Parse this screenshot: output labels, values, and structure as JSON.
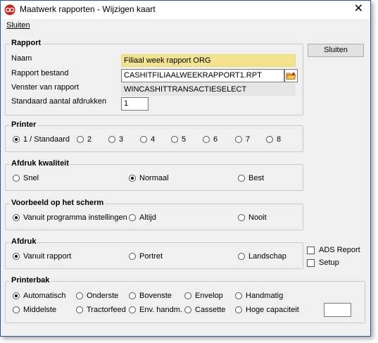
{
  "window": {
    "title": "Maatwerk rapporten - Wijzigen kaart",
    "close_glyph": "✕",
    "accent": "#cc2222"
  },
  "menu": {
    "items": [
      "Sluiten"
    ]
  },
  "close_button": "Sluiten",
  "rapport": {
    "legend": "Rapport",
    "naam_label": "Naam",
    "naam_value": "Filiaal week rapport ORG",
    "bestand_label": "Rapport bestand",
    "bestand_value": "CASHITFILIAALWEEKRAPPORT1.RPT",
    "venster_label": "Venster van rapport",
    "venster_value": "WINCASHITTRANSACTIESELECT",
    "afdrukken_label": "Standaard aantal afdrukken",
    "afdrukken_value": "1",
    "browse_icon": "folder-open-icon"
  },
  "printer": {
    "legend": "Printer",
    "options": [
      "1 / Standaard",
      "2",
      "3",
      "4",
      "5",
      "6",
      "7",
      "8"
    ],
    "selected": "1 / Standaard"
  },
  "kwaliteit": {
    "legend": "Afdruk kwaliteit",
    "options": [
      "Snel",
      "Normaal",
      "Best"
    ],
    "selected": "Normaal"
  },
  "voorbeeld": {
    "legend": "Voorbeeld op het scherm",
    "options": [
      "Vanuit programma instellingen",
      "Altijd",
      "Nooit"
    ],
    "selected": "Vanuit programma instellingen"
  },
  "afdruk": {
    "legend": "Afdruk",
    "options": [
      "Vanuit rapport",
      "Portret",
      "Landschap"
    ],
    "selected": "Vanuit rapport"
  },
  "checks": {
    "ads_report": "ADS Report",
    "setup": "Setup",
    "ads_checked": false,
    "setup_checked": false
  },
  "printerbak": {
    "legend": "Printerbak",
    "options": [
      "Automatisch",
      "Onderste",
      "Bovenste",
      "Envelop",
      "Handmatig",
      "Middelste",
      "Tractorfeed",
      "Env. handm.",
      "Cassette",
      "Hoge capaciteit"
    ],
    "selected": "Automatisch",
    "custom_value": ""
  }
}
